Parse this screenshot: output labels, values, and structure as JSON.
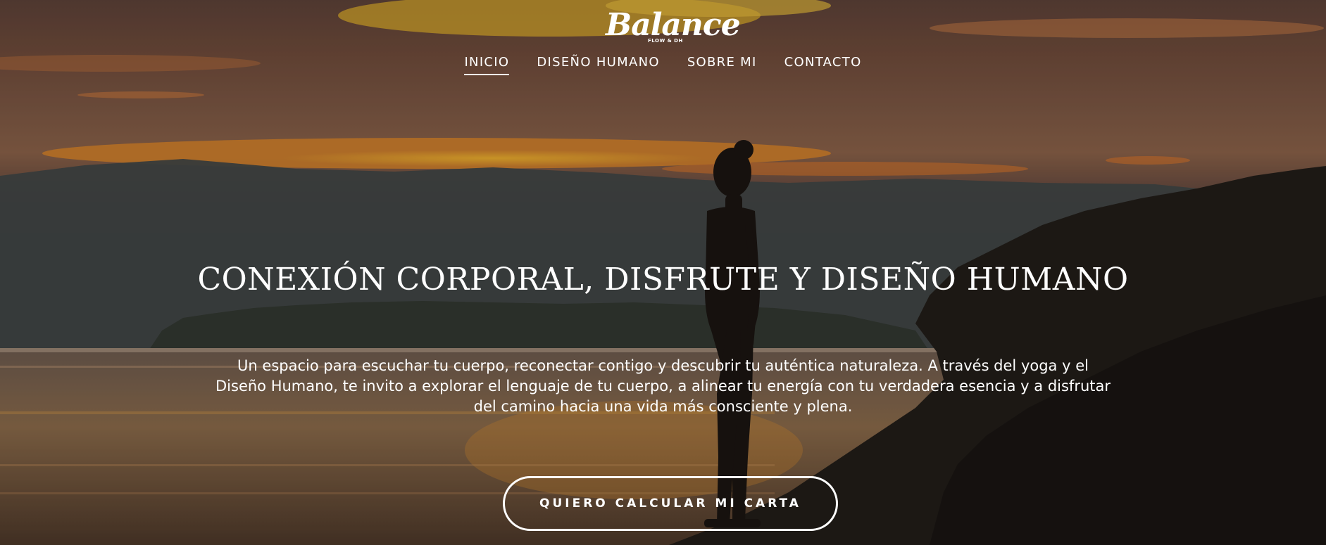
{
  "brand": {
    "logo_text": "Balance",
    "logo_subtext": "FLOW & DH"
  },
  "nav": {
    "items": [
      {
        "label": "INICIO",
        "active": true
      },
      {
        "label": "DISEÑO HUMANO",
        "active": false
      },
      {
        "label": "SOBRE MI",
        "active": false
      },
      {
        "label": "CONTACTO",
        "active": false
      }
    ]
  },
  "hero": {
    "headline": "CONEXIÓN CORPORAL, DISFRUTE Y DISEÑO HUMANO",
    "intro": "Un espacio para escuchar tu cuerpo, reconectar contigo y descubrir tu auténtica naturaleza. A través del yoga y el Diseño Humano, te invito a explorar el lenguaje de tu cuerpo, a alinear tu energía con tu verdadera esencia y a disfrutar del camino hacia una vida más consciente y plena.",
    "cta_label": "QUIERO CALCULAR MI CARTA"
  },
  "colors": {
    "text": "#ffffff",
    "sunset_glow": "#e8a22a",
    "sky_dusk": "#6e4a3a"
  }
}
